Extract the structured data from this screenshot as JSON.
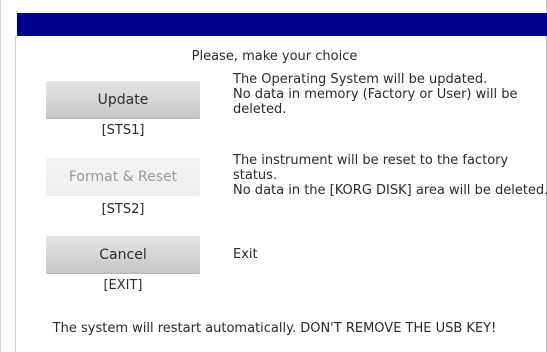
{
  "header": {
    "bar_color": "#00008f"
  },
  "prompt": "Please, make your choice",
  "options": [
    {
      "label": "Update",
      "code": "[STS1]",
      "enabled": true,
      "description": [
        "The Operating System will be updated.",
        "No data in memory (Factory or User) will be",
        "deleted."
      ]
    },
    {
      "label": "Format & Reset",
      "code": "[STS2]",
      "enabled": false,
      "description": [
        "The instrument will be reset to the factory",
        "status.",
        "No data in the [KORG DISK] area will be deleted."
      ]
    },
    {
      "label": "Cancel",
      "code": "[EXIT]",
      "enabled": true,
      "description": [
        "Exit"
      ]
    }
  ],
  "footer": "The system will restart automatically. DON'T REMOVE THE USB KEY!"
}
